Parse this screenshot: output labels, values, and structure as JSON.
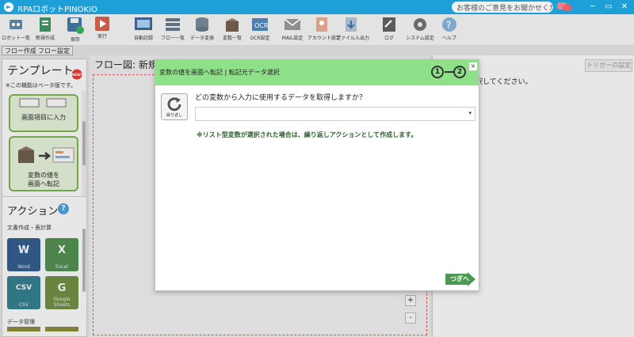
{
  "titlebar": {
    "app_title": "RPAロボットPINOKIO",
    "feedback": "お客様のご意見をお聞かせください",
    "minimize": "─",
    "maximize": "▭",
    "close": "✕"
  },
  "toolbar": {
    "items": [
      {
        "label": "ロボット一覧"
      },
      {
        "label": "新規作成"
      },
      {
        "label": "保存"
      },
      {
        "label": "実行"
      },
      {
        "label": "自動記録"
      },
      {
        "label": "フロー一覧"
      },
      {
        "label": "データ変換"
      },
      {
        "label": "変数一覧"
      },
      {
        "label": "OCR設定"
      },
      {
        "label": "MAIL設定"
      },
      {
        "label": "アカウント設定"
      },
      {
        "label": "ファイル入出力"
      },
      {
        "label": "ログ"
      },
      {
        "label": "システム設定"
      },
      {
        "label": "ヘルプ"
      }
    ]
  },
  "tabs": [
    {
      "label": "フロー作成"
    },
    {
      "label": "フロー設定"
    }
  ],
  "templates": {
    "title": "テンプレート",
    "badge": "NEW!",
    "beta_note": "※この機能はベータ版です。",
    "card1_label": "画面項目に入力",
    "card2_line1": "変数の値を",
    "card2_line2": "画面へ転記"
  },
  "actions": {
    "title": "アクション",
    "help": "?",
    "category1": "文書作成・表計算",
    "tiles": [
      {
        "label": "Word",
        "glyph": "W",
        "color": "#2f5a8f"
      },
      {
        "label": "Excel",
        "glyph": "X",
        "color": "#4f8f4f"
      },
      {
        "label": "CSV",
        "glyph": "CSV",
        "color": "#2f7f8f"
      },
      {
        "label": "Google Sheets",
        "glyph": "G",
        "color": "#6f8f3f"
      }
    ],
    "category2": "データ管理"
  },
  "flow": {
    "title": "フロー図:  新規",
    "zoom_in": "+",
    "zoom_out": "-"
  },
  "right_panel": {
    "trigger_button": "トリガーの設定",
    "hint": "クションを選択してください。"
  },
  "modal": {
    "title": "変数の値を画面へ転記 | 転記元データ選択",
    "step1": "1",
    "step2": "2",
    "close": "×",
    "repeat_label": "繰り返し",
    "question": "どの変数から入力に使用するデータを取得しますか？",
    "select_value": "",
    "select_arrow": "▾",
    "note": "※リスト型変数が選択された場合は、繰り返しアクションとして作成します。",
    "next_button": "つぎへ"
  },
  "colors": {
    "titlebar": "#1e9fd8",
    "modal_header": "#8fe189",
    "template_card_border": "#7ab648",
    "flow_canvas_border": "#e25a5a",
    "next_button": "#4c9a52"
  }
}
